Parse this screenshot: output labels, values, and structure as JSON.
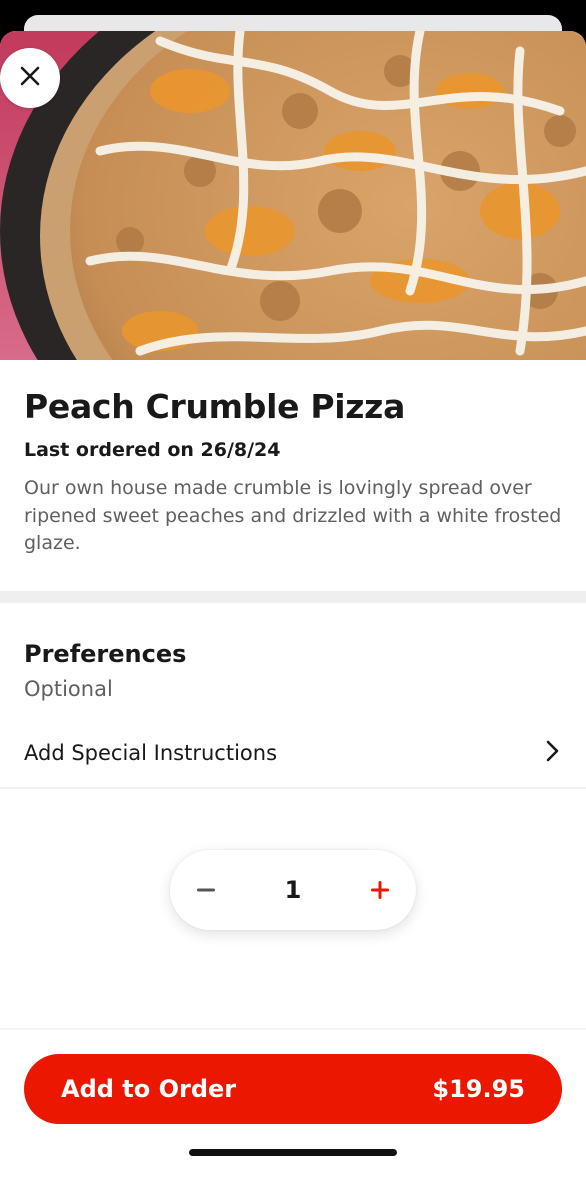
{
  "item": {
    "title": "Peach Crumble Pizza",
    "last_ordered": "Last ordered on 26/8/24",
    "description": "Our own house made crumble is lovingly spread over ripened sweet peaches and drizzled with a white frosted glaze."
  },
  "preferences": {
    "title": "Preferences",
    "subtitle": "Optional",
    "special_instructions_label": "Add Special Instructions"
  },
  "quantity": {
    "value": "1"
  },
  "order_button": {
    "label": "Add to Order",
    "price": "$19.95"
  },
  "icons": {
    "close": "close-icon",
    "chevron": "chevron-right-icon",
    "minus": "minus-icon",
    "plus": "plus-icon"
  },
  "colors": {
    "accent": "#eb1700",
    "text_primary": "#191919",
    "text_secondary": "#606060"
  }
}
